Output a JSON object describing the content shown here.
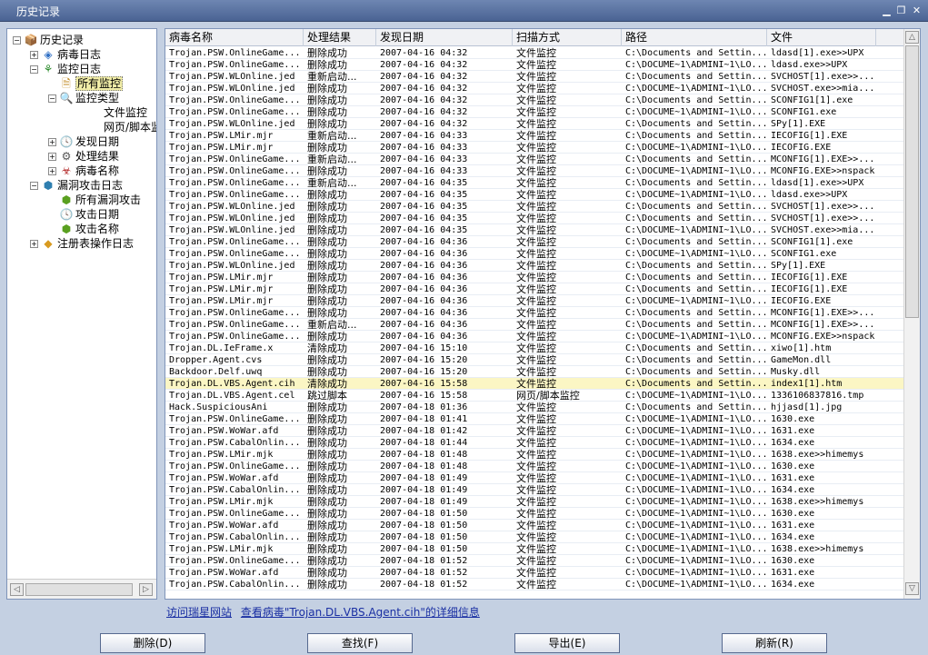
{
  "window": {
    "title": "历史记录"
  },
  "tree": [
    {
      "label": "历史记录",
      "icon": "history-icon"
    },
    {
      "label": "病毒日志",
      "icon": "virus-log-icon"
    },
    {
      "label": "监控日志",
      "icon": "monitor-log-icon"
    },
    {
      "label": "所有监控",
      "icon": "all-monitor-icon",
      "selected": true
    },
    {
      "label": "监控类型",
      "icon": "search-icon"
    },
    {
      "label": "文件监控",
      "icon": ""
    },
    {
      "label": "网页/脚本监",
      "icon": ""
    },
    {
      "label": "发现日期",
      "icon": "clock-icon"
    },
    {
      "label": "处理结果",
      "icon": "result-icon"
    },
    {
      "label": "病毒名称",
      "icon": "virus-name-icon"
    },
    {
      "label": "漏洞攻击日志",
      "icon": "exploit-log-icon"
    },
    {
      "label": "所有漏洞攻击",
      "icon": "all-exploit-icon"
    },
    {
      "label": "攻击日期",
      "icon": "clock-icon"
    },
    {
      "label": "攻击名称",
      "icon": "attack-name-icon"
    },
    {
      "label": "注册表操作日志",
      "icon": "registry-log-icon"
    }
  ],
  "columns": [
    "病毒名称",
    "处理结果",
    "发现日期",
    "扫描方式",
    "路径",
    "文件"
  ],
  "rows": [
    [
      "Trojan.PSW.OnlineGame...",
      "删除成功",
      "2007-04-16 04:32",
      "文件监控",
      "C:\\Documents and Settin...",
      "ldasd[1].exe>>UPX"
    ],
    [
      "Trojan.PSW.OnlineGame...",
      "删除成功",
      "2007-04-16 04:32",
      "文件监控",
      "C:\\DOCUME~1\\ADMINI~1\\LO...",
      "ldasd.exe>>UPX"
    ],
    [
      "Trojan.PSW.WLOnline.jed",
      "重新启动...",
      "2007-04-16 04:32",
      "文件监控",
      "C:\\Documents and Settin...",
      "SVCHOST[1].exe>>..."
    ],
    [
      "Trojan.PSW.WLOnline.jed",
      "删除成功",
      "2007-04-16 04:32",
      "文件监控",
      "C:\\DOCUME~1\\ADMINI~1\\LO...",
      "SVCHOST.exe>>mia..."
    ],
    [
      "Trojan.PSW.OnlineGame...",
      "删除成功",
      "2007-04-16 04:32",
      "文件监控",
      "C:\\Documents and Settin...",
      "SCONFIG1[1].exe"
    ],
    [
      "Trojan.PSW.OnlineGame...",
      "删除成功",
      "2007-04-16 04:32",
      "文件监控",
      "C:\\DOCUME~1\\ADMINI~1\\LO...",
      "SCONFIG1.exe"
    ],
    [
      "Trojan.PSW.WLOnline.jed",
      "删除成功",
      "2007-04-16 04:32",
      "文件监控",
      "C:\\Documents and Settin...",
      "SPy[1].EXE"
    ],
    [
      "Trojan.PSW.LMir.mjr",
      "重新启动...",
      "2007-04-16 04:33",
      "文件监控",
      "C:\\Documents and Settin...",
      "IECOFIG[1].EXE"
    ],
    [
      "Trojan.PSW.LMir.mjr",
      "删除成功",
      "2007-04-16 04:33",
      "文件监控",
      "C:\\DOCUME~1\\ADMINI~1\\LO...",
      "IECOFIG.EXE"
    ],
    [
      "Trojan.PSW.OnlineGame...",
      "重新启动...",
      "2007-04-16 04:33",
      "文件监控",
      "C:\\Documents and Settin...",
      "MCONFIG[1].EXE>>..."
    ],
    [
      "Trojan.PSW.OnlineGame...",
      "删除成功",
      "2007-04-16 04:33",
      "文件监控",
      "C:\\DOCUME~1\\ADMINI~1\\LO...",
      "MCONFIG.EXE>>nspack"
    ],
    [
      "Trojan.PSW.OnlineGame...",
      "重新启动...",
      "2007-04-16 04:35",
      "文件监控",
      "C:\\Documents and Settin...",
      "ldasd[1].exe>>UPX"
    ],
    [
      "Trojan.PSW.OnlineGame...",
      "删除成功",
      "2007-04-16 04:35",
      "文件监控",
      "C:\\DOCUME~1\\ADMINI~1\\LO...",
      "ldasd.exe>>UPX"
    ],
    [
      "Trojan.PSW.WLOnline.jed",
      "删除成功",
      "2007-04-16 04:35",
      "文件监控",
      "C:\\Documents and Settin...",
      "SVCHOST[1].exe>>..."
    ],
    [
      "Trojan.PSW.WLOnline.jed",
      "删除成功",
      "2007-04-16 04:35",
      "文件监控",
      "C:\\Documents and Settin...",
      "SVCHOST[1].exe>>..."
    ],
    [
      "Trojan.PSW.WLOnline.jed",
      "删除成功",
      "2007-04-16 04:35",
      "文件监控",
      "C:\\DOCUME~1\\ADMINI~1\\LO...",
      "SVCHOST.exe>>mia..."
    ],
    [
      "Trojan.PSW.OnlineGame...",
      "删除成功",
      "2007-04-16 04:36",
      "文件监控",
      "C:\\Documents and Settin...",
      "SCONFIG1[1].exe"
    ],
    [
      "Trojan.PSW.OnlineGame...",
      "删除成功",
      "2007-04-16 04:36",
      "文件监控",
      "C:\\DOCUME~1\\ADMINI~1\\LO...",
      "SCONFIG1.exe"
    ],
    [
      "Trojan.PSW.WLOnline.jed",
      "删除成功",
      "2007-04-16 04:36",
      "文件监控",
      "C:\\Documents and Settin...",
      "SPy[1].EXE"
    ],
    [
      "Trojan.PSW.LMir.mjr",
      "删除成功",
      "2007-04-16 04:36",
      "文件监控",
      "C:\\Documents and Settin...",
      "IECOFIG[1].EXE"
    ],
    [
      "Trojan.PSW.LMir.mjr",
      "删除成功",
      "2007-04-16 04:36",
      "文件监控",
      "C:\\Documents and Settin...",
      "IECOFIG[1].EXE"
    ],
    [
      "Trojan.PSW.LMir.mjr",
      "删除成功",
      "2007-04-16 04:36",
      "文件监控",
      "C:\\DOCUME~1\\ADMINI~1\\LO...",
      "IECOFIG.EXE"
    ],
    [
      "Trojan.PSW.OnlineGame...",
      "删除成功",
      "2007-04-16 04:36",
      "文件监控",
      "C:\\Documents and Settin...",
      "MCONFIG[1].EXE>>..."
    ],
    [
      "Trojan.PSW.OnlineGame...",
      "重新启动...",
      "2007-04-16 04:36",
      "文件监控",
      "C:\\Documents and Settin...",
      "MCONFIG[1].EXE>>..."
    ],
    [
      "Trojan.PSW.OnlineGame...",
      "删除成功",
      "2007-04-16 04:36",
      "文件监控",
      "C:\\DOCUME~1\\ADMINI~1\\LO...",
      "MCONFIG.EXE>>nspack"
    ],
    [
      "Trojan.DL.IeFrame.x",
      "清除成功",
      "2007-04-16 15:10",
      "文件监控",
      "C:\\Documents and Settin...",
      "xiwo[1].htm"
    ],
    [
      "Dropper.Agent.cvs",
      "删除成功",
      "2007-04-16 15:20",
      "文件监控",
      "C:\\Documents and Settin...",
      "GameMon.dll"
    ],
    [
      "Backdoor.Delf.uwq",
      "删除成功",
      "2007-04-16 15:20",
      "文件监控",
      "C:\\Documents and Settin...",
      "Musky.dll"
    ],
    [
      "Trojan.DL.VBS.Agent.cih",
      "清除成功",
      "2007-04-16 15:58",
      "文件监控",
      "C:\\Documents and Settin...",
      "index1[1].htm"
    ],
    [
      "Trojan.DL.VBS.Agent.cel",
      "跳过脚本",
      "2007-04-16 15:58",
      "网页/脚本监控",
      "C:\\DOCUME~1\\ADMINI~1\\LO...",
      "1336106837816.tmp"
    ],
    [
      "Hack.SuspiciousAni",
      "删除成功",
      "2007-04-18 01:36",
      "文件监控",
      "C:\\Documents and Settin...",
      "hjjasd[1].jpg"
    ],
    [
      "Trojan.PSW.OnlineGame...",
      "删除成功",
      "2007-04-18 01:41",
      "文件监控",
      "C:\\DOCUME~1\\ADMINI~1\\LO...",
      "1630.exe"
    ],
    [
      "Trojan.PSW.WoWar.afd",
      "删除成功",
      "2007-04-18 01:42",
      "文件监控",
      "C:\\DOCUME~1\\ADMINI~1\\LO...",
      "1631.exe"
    ],
    [
      "Trojan.PSW.CabalOnlin...",
      "删除成功",
      "2007-04-18 01:44",
      "文件监控",
      "C:\\DOCUME~1\\ADMINI~1\\LO...",
      "1634.exe"
    ],
    [
      "Trojan.PSW.LMir.mjk",
      "删除成功",
      "2007-04-18 01:48",
      "文件监控",
      "C:\\DOCUME~1\\ADMINI~1\\LO...",
      "1638.exe>>himemys"
    ],
    [
      "Trojan.PSW.OnlineGame...",
      "删除成功",
      "2007-04-18 01:48",
      "文件监控",
      "C:\\DOCUME~1\\ADMINI~1\\LO...",
      "1630.exe"
    ],
    [
      "Trojan.PSW.WoWar.afd",
      "删除成功",
      "2007-04-18 01:49",
      "文件监控",
      "C:\\DOCUME~1\\ADMINI~1\\LO...",
      "1631.exe"
    ],
    [
      "Trojan.PSW.CabalOnlin...",
      "删除成功",
      "2007-04-18 01:49",
      "文件监控",
      "C:\\DOCUME~1\\ADMINI~1\\LO...",
      "1634.exe"
    ],
    [
      "Trojan.PSW.LMir.mjk",
      "删除成功",
      "2007-04-18 01:49",
      "文件监控",
      "C:\\DOCUME~1\\ADMINI~1\\LO...",
      "1638.exe>>himemys"
    ],
    [
      "Trojan.PSW.OnlineGame...",
      "删除成功",
      "2007-04-18 01:50",
      "文件监控",
      "C:\\DOCUME~1\\ADMINI~1\\LO...",
      "1630.exe"
    ],
    [
      "Trojan.PSW.WoWar.afd",
      "删除成功",
      "2007-04-18 01:50",
      "文件监控",
      "C:\\DOCUME~1\\ADMINI~1\\LO...",
      "1631.exe"
    ],
    [
      "Trojan.PSW.CabalOnlin...",
      "删除成功",
      "2007-04-18 01:50",
      "文件监控",
      "C:\\DOCUME~1\\ADMINI~1\\LO...",
      "1634.exe"
    ],
    [
      "Trojan.PSW.LMir.mjk",
      "删除成功",
      "2007-04-18 01:50",
      "文件监控",
      "C:\\DOCUME~1\\ADMINI~1\\LO...",
      "1638.exe>>himemys"
    ],
    [
      "Trojan.PSW.OnlineGame...",
      "删除成功",
      "2007-04-18 01:52",
      "文件监控",
      "C:\\DOCUME~1\\ADMINI~1\\LO...",
      "1630.exe"
    ],
    [
      "Trojan.PSW.WoWar.afd",
      "删除成功",
      "2007-04-18 01:52",
      "文件监控",
      "C:\\DOCUME~1\\ADMINI~1\\LO...",
      "1631.exe"
    ],
    [
      "Trojan.PSW.CabalOnlin...",
      "删除成功",
      "2007-04-18 01:52",
      "文件监控",
      "C:\\DOCUME~1\\ADMINI~1\\LO...",
      "1634.exe"
    ]
  ],
  "selected_row": 28,
  "links": {
    "visit_site": "访问瑞星网站",
    "view_detail": "查看病毒\"Trojan.DL.VBS.Agent.cih\"的详细信息"
  },
  "buttons": {
    "delete": "删除(D)",
    "find": "查找(F)",
    "export": "导出(E)",
    "refresh": "刷新(R)"
  },
  "colors": {
    "titlebar": "#5a73a4",
    "link": "#1a2fa3",
    "selection": "#fbf6c4"
  }
}
